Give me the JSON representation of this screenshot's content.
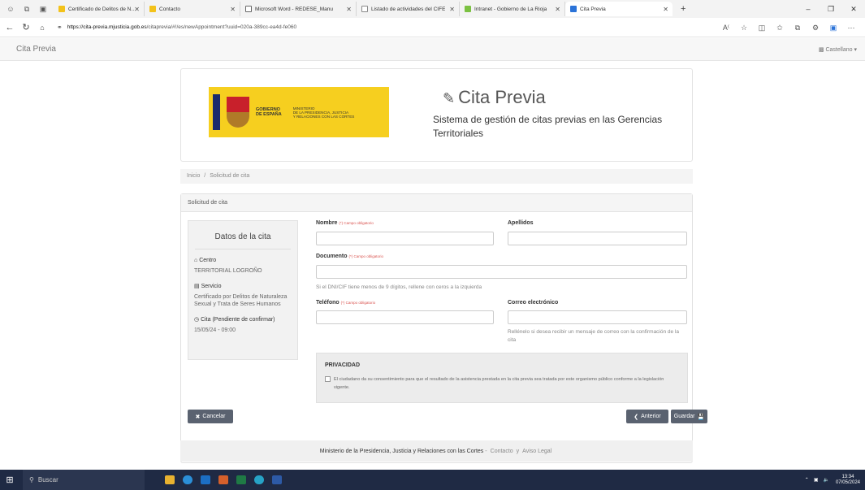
{
  "browser": {
    "tabs": [
      {
        "label": "Certificado de Delitos de Naturaleza",
        "fav": "#f3c21a"
      },
      {
        "label": "Contacto",
        "fav": "#f3c21a"
      },
      {
        "label": "Microsoft Word - REDESE_Manu",
        "fav": "#666"
      },
      {
        "label": "Listado de actividades del CIFE",
        "fav": "#888"
      },
      {
        "label": "Intranet - Gobierno de La Rioja",
        "fav": "#7bc142"
      },
      {
        "label": "Cita Previa",
        "fav": "#2b73d8"
      }
    ],
    "url_host": "https://cita-previa.mjusticia.gob.es",
    "url_path": "/citaprevia/#!/es/newAppointment?uuid=020a-389cc-ea4d-fe060"
  },
  "site": {
    "name": "Cita Previa",
    "language": "Castellano"
  },
  "header": {
    "gov_line1": "GOBIERNO",
    "gov_line2": "DE ESPAÑA",
    "ministry_line1": "MINISTERIO",
    "ministry_line2": "DE LA PRESIDENCIA, JUSTICIA",
    "ministry_line3": "Y RELACIONES CON LAS CORTES",
    "title": "Cita Previa",
    "subtitle": "Sistema de gestión de citas previas en las Gerencias Territoriales"
  },
  "breadcrumb": {
    "home": "Inicio",
    "sep": "/",
    "current": "Solicitud de cita"
  },
  "panel": {
    "title": "Solicitud de cita"
  },
  "summary": {
    "title": "Datos de la cita",
    "centro_label": "Centro",
    "centro_value": "TERRITORIAL LOGROÑO",
    "servicio_label": "Servicio",
    "servicio_value": "Certificado por Delitos de Naturaleza Sexual y Trata de Seres Humanos",
    "cita_label": "Cita (Pendiente de confirmar)",
    "cita_value": "15/05/24 - 09:00"
  },
  "form": {
    "required_note": "(*) Campo obligatorio",
    "nombre_label": "Nombre",
    "apellidos_label": "Apellidos",
    "documento_label": "Documento",
    "documento_help": "Si el DNI/CIF tiene menos de 9 dígitos, rellene con ceros a la izquierda",
    "telefono_label": "Teléfono",
    "correo_label": "Correo electrónico",
    "correo_help": "Rellénelo si desea recibir un mensaje de correo con la confirmación de la cita"
  },
  "privacy": {
    "title": "PRIVACIDAD",
    "text": "El ciudadano da su consentimiento para que el resultado de la asistencia prestada en la cita previa sea tratada por este organismo público conforme a la legislación vigente."
  },
  "buttons": {
    "cancel": "Cancelar",
    "previous": "Anterior",
    "save": "Guardar"
  },
  "footer": {
    "text": "Ministerio de la Presidencia, Justicia y Relaciones con las Cortes",
    "dash": "-",
    "contact": "Contacto",
    "and": "y",
    "legal": "Aviso Legal"
  },
  "taskbar": {
    "search": "Buscar",
    "time": "13:34",
    "date": "07/05/2024"
  }
}
